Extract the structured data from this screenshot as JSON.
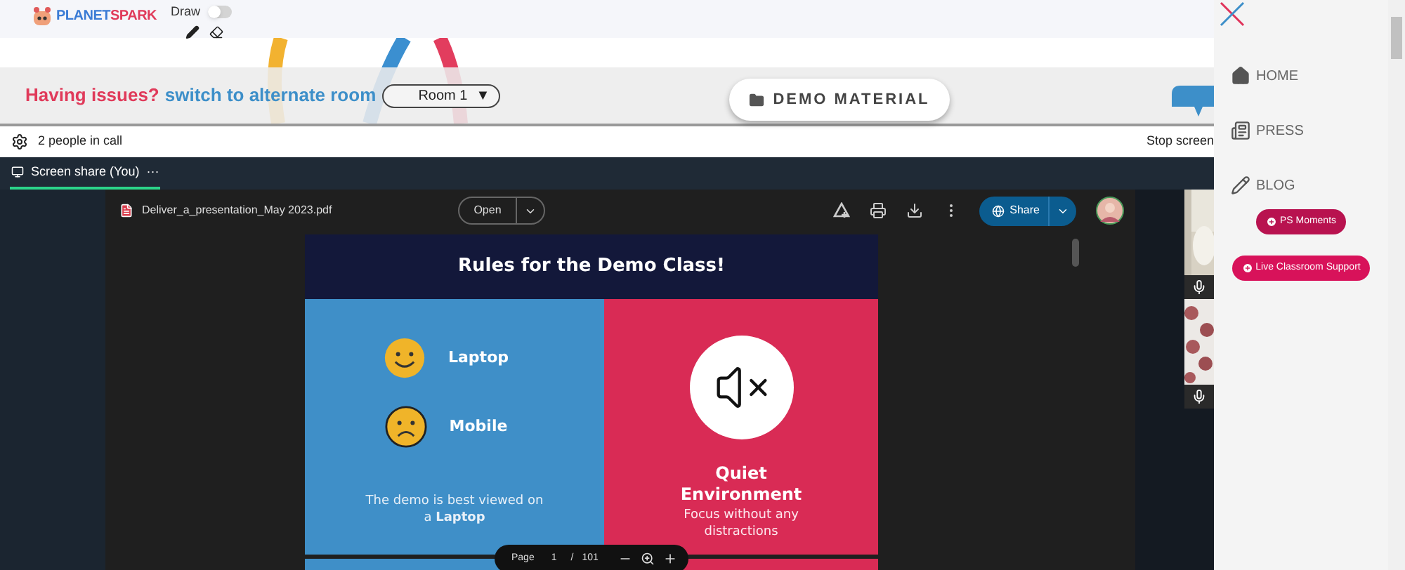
{
  "header": {
    "logo": {
      "word_1": "PLANET",
      "word_2": "SPARK"
    },
    "draw_toggle": {
      "label": "Draw",
      "on": false
    }
  },
  "room_bar": {
    "issue_text": "Having issues?",
    "switch_link": "switch to alternate room",
    "room_select": {
      "value": "Room 1",
      "caret": "▼"
    }
  },
  "demo_material_button": "DEMO MATERIAL",
  "call_bar": {
    "people": "2 people in call",
    "stop_button": "Stop screen"
  },
  "tabs": [
    {
      "label": "Screen share (You)",
      "selected": true
    }
  ],
  "tab_more": "···",
  "pdf_viewer": {
    "filename": "Deliver_a_presentation_May 2023.pdf",
    "open_button": "Open",
    "share_button": "Share",
    "page_label": "Page",
    "page_number": "1",
    "page_separator": "/",
    "page_total": "101"
  },
  "slide": {
    "title": "Rules for the Demo Class!",
    "left": {
      "items": [
        {
          "label": "Laptop",
          "kind": "happy"
        },
        {
          "label": "Mobile",
          "kind": "sad"
        }
      ],
      "caption": "The demo is best viewed on a **Laptop**"
    },
    "right": {
      "title": "Quiet Environment",
      "caption": "Focus without any distractions"
    }
  },
  "sidebar": {
    "nav": [
      {
        "label": "HOME"
      },
      {
        "label": "PRESS"
      },
      {
        "label": "BLOG"
      }
    ],
    "buttons": [
      {
        "label": "PS Moments",
        "color": "#b8124f"
      },
      {
        "label": "Live Classroom Support",
        "color": "#d8125a"
      }
    ]
  }
}
